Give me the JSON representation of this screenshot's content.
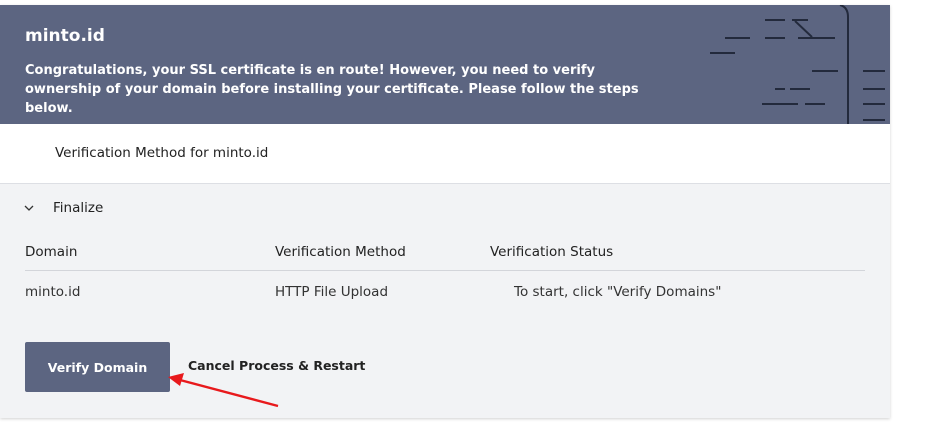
{
  "header": {
    "title": "minto.id",
    "message": "Congratulations, your SSL certificate is en route! However, you need to verify ownership of your domain before installing your certificate. Please follow the steps below."
  },
  "method_section": {
    "title": "Verification Method for minto.id"
  },
  "finalize": {
    "label": "Finalize",
    "expanded": true
  },
  "table": {
    "headers": [
      "Domain",
      "Verification Method",
      "Verification Status"
    ],
    "rows": [
      {
        "domain": "minto.id",
        "method": "HTTP File Upload",
        "status": "To start, click \"Verify Domains\""
      }
    ]
  },
  "actions": {
    "verify_label": "Verify Domain",
    "cancel_label": "Cancel Process & Restart"
  },
  "colors": {
    "header_bg": "#5c6581",
    "button_bg": "#5c6581",
    "panel_bg": "#f2f3f5",
    "annotation": "#e8191c"
  }
}
